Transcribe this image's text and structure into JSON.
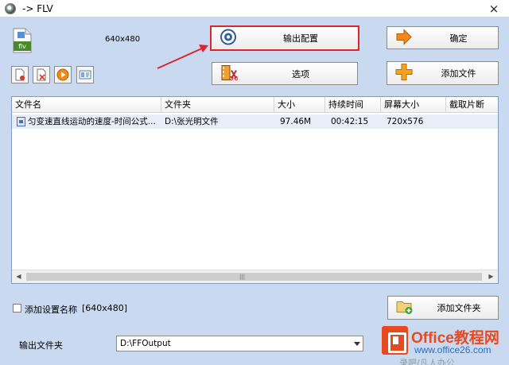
{
  "window": {
    "title": "-> FLV",
    "close_glyph": "×"
  },
  "format_icon": {
    "name": "flv-format-icon",
    "label": "flv"
  },
  "resolution_label": "640x480",
  "small_tools": [
    {
      "name": "remove-file-tool",
      "icon": "remove-icon"
    },
    {
      "name": "clear-list-tool",
      "icon": "delete-icon"
    },
    {
      "name": "play-tool",
      "icon": "play-icon"
    },
    {
      "name": "info-tool",
      "icon": "info-icon"
    }
  ],
  "buttons": {
    "output_config": "输出配置",
    "options": "选项",
    "confirm": "确定",
    "add_file": "添加文件",
    "add_folder": "添加文件夹"
  },
  "file_table": {
    "columns": [
      "文件名",
      "文件夹",
      "大小",
      "持续时间",
      "屏幕大小",
      "截取片断"
    ],
    "rows": [
      {
        "name": "匀变速直线运动的速度-时间公式...",
        "folder": "D:\\张光明文件",
        "size": "97.46M",
        "duration": "00:42:15",
        "screen": "720x576",
        "clip": ""
      }
    ]
  },
  "settings": {
    "add_name_label": "添加设置名称",
    "add_name_res": "[640x480]",
    "add_name_checked": false
  },
  "output": {
    "label": "输出文件夹",
    "path": "D:\\FFOutput"
  },
  "watermark": {
    "brand": "Office教程网",
    "url": "www.office26.com",
    "gray_text": "录吧/凡人办公"
  },
  "colors": {
    "window_bg": "#c9daf0",
    "highlight_border": "#e0242f",
    "annotation_arrow": "#e0242f",
    "selected_row": "#e8eef8",
    "watermark_orange": "#e84a1f",
    "watermark_blue": "#2b6cc4"
  }
}
